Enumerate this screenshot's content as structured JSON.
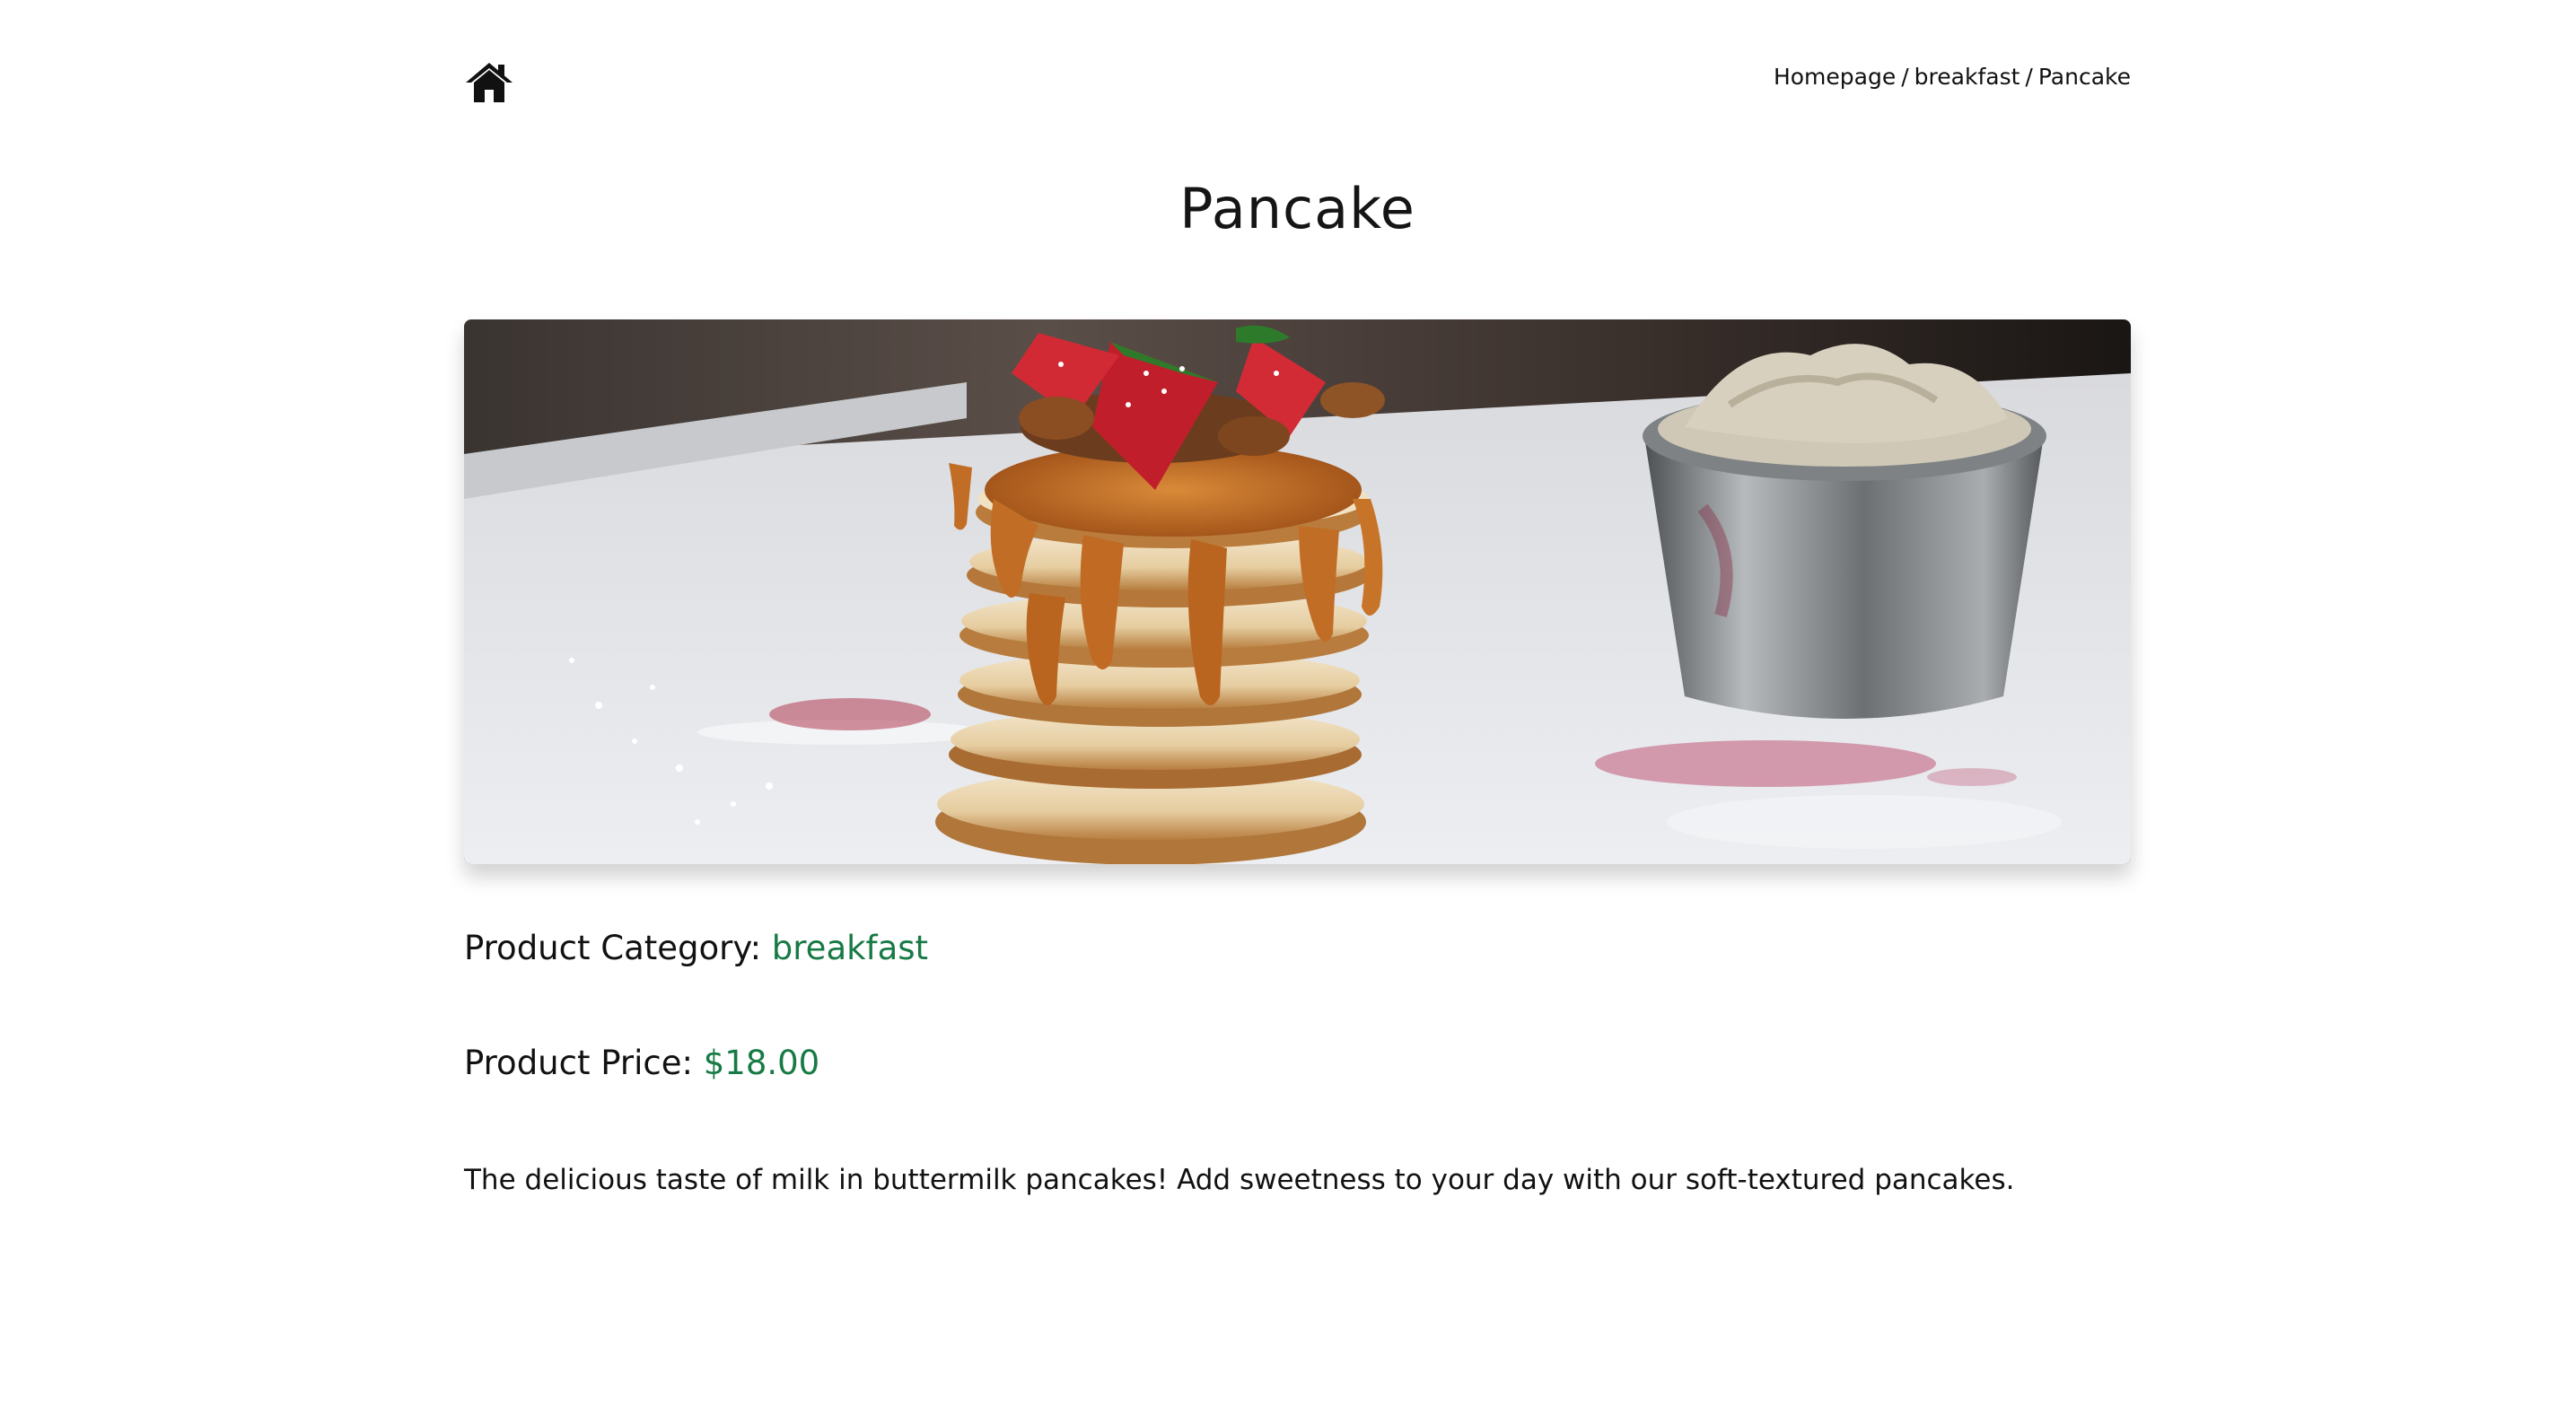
{
  "header": {
    "home_icon": "home-icon",
    "breadcrumb": {
      "items": [
        "Homepage",
        "breakfast",
        "Pancake"
      ],
      "separator": "/"
    }
  },
  "page": {
    "title": "Pancake"
  },
  "product": {
    "image_alt": "pancake stack with caramel sauce and strawberries",
    "category_label": "Product Category:",
    "category_value": "breakfast",
    "price_label": "Product Price:",
    "price_value": "$18.00",
    "description": "The delicious taste of milk in buttermilk pancakes! Add sweetness to your day with our soft-textured pancakes."
  },
  "colors": {
    "accent": "#177a45",
    "text": "#111111",
    "background": "#ffffff"
  }
}
